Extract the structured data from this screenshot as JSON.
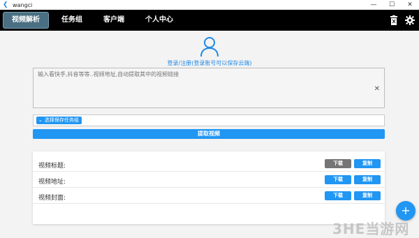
{
  "window": {
    "title": "wangci"
  },
  "nav": {
    "tabs": [
      {
        "label": "视频解析"
      },
      {
        "label": "任务组"
      },
      {
        "label": "客户端"
      },
      {
        "label": "个人中心"
      }
    ],
    "icons": [
      "trash-icon",
      "gear-icon"
    ]
  },
  "login": {
    "link_text": "登录/注册(登录账号可以保存云端)"
  },
  "url_input": {
    "placeholder": "输入看快手,抖音等等..视频地址,自动提取其中的视频链接",
    "value": ""
  },
  "group_select": {
    "label": "选择保存任务组"
  },
  "extract": {
    "label": "提取视频"
  },
  "results": [
    {
      "label": "视频标题:",
      "download": "下载",
      "copy": "复制",
      "download_disabled": true
    },
    {
      "label": "视频地址:",
      "download": "下载",
      "copy": "复制",
      "download_disabled": false
    },
    {
      "label": "视频封面:",
      "download": "下载",
      "copy": "复制",
      "download_disabled": false
    }
  ],
  "fab": {
    "label": "+"
  },
  "watermark": {
    "text": "3HE当游网"
  },
  "colors": {
    "accent": "#2196f3",
    "nav_bg": "#000000",
    "disabled": "#757575"
  }
}
